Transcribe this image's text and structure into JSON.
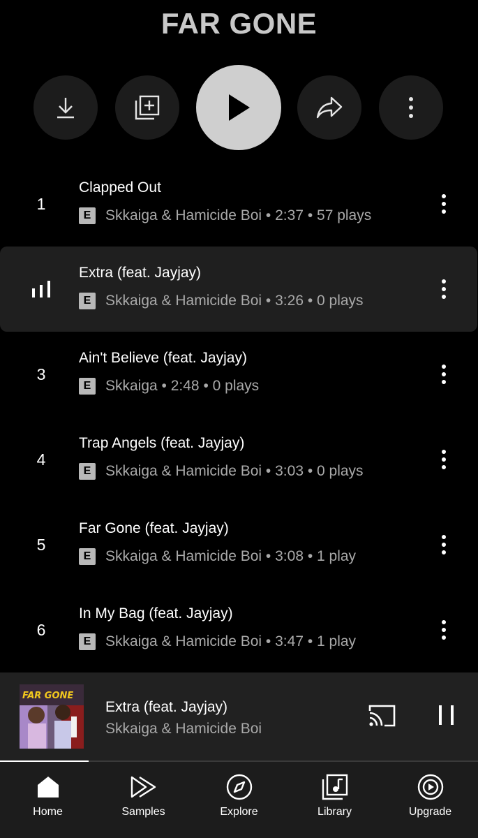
{
  "album": {
    "title": "FAR GONE"
  },
  "actions": {
    "download": "download-icon",
    "add_to_library": "add-to-library-icon",
    "play": "play-icon",
    "share": "share-icon",
    "more": "more-vertical-icon"
  },
  "tracks": [
    {
      "number": "1",
      "title": "Clapped Out",
      "badge": "E",
      "subtitle": "Skkaiga & Hamicide Boi • 2:37 • 57 plays",
      "playing": false
    },
    {
      "number": "",
      "title": "Extra (feat. Jayjay)",
      "badge": "E",
      "subtitle": "Skkaiga & Hamicide Boi • 3:26 • 0 plays",
      "playing": true
    },
    {
      "number": "3",
      "title": "Ain't Believe (feat. Jayjay)",
      "badge": "E",
      "subtitle": "Skkaiga • 2:48 • 0 plays",
      "playing": false
    },
    {
      "number": "4",
      "title": "Trap Angels (feat. Jayjay)",
      "badge": "E",
      "subtitle": "Skkaiga & Hamicide Boi • 3:03 • 0 plays",
      "playing": false
    },
    {
      "number": "5",
      "title": "Far Gone (feat. Jayjay)",
      "badge": "E",
      "subtitle": "Skkaiga & Hamicide Boi • 3:08 • 1 play",
      "playing": false
    },
    {
      "number": "6",
      "title": "In My Bag (feat. Jayjay)",
      "badge": "E",
      "subtitle": "Skkaiga & Hamicide Boi • 3:47 • 1 play",
      "playing": false
    }
  ],
  "now_playing": {
    "title": "Extra (feat. Jayjay)",
    "artist": "Skkaiga & Hamicide Boi",
    "art_text": "FAR GONE",
    "progress": 0.186
  },
  "nav": {
    "items": [
      {
        "label": "Home",
        "icon": "home-icon",
        "active": true
      },
      {
        "label": "Samples",
        "icon": "samples-icon",
        "active": false
      },
      {
        "label": "Explore",
        "icon": "compass-icon",
        "active": false
      },
      {
        "label": "Library",
        "icon": "library-icon",
        "active": false
      },
      {
        "label": "Upgrade",
        "icon": "upgrade-icon",
        "active": false
      }
    ]
  },
  "colors": {
    "background": "#000000",
    "title_gray": "#c8c8c8",
    "secondary_text": "#a9a9a9",
    "playing_row": "#1f1f1f",
    "mini_player": "#212121",
    "nav_bar": "#1c1c1c"
  }
}
